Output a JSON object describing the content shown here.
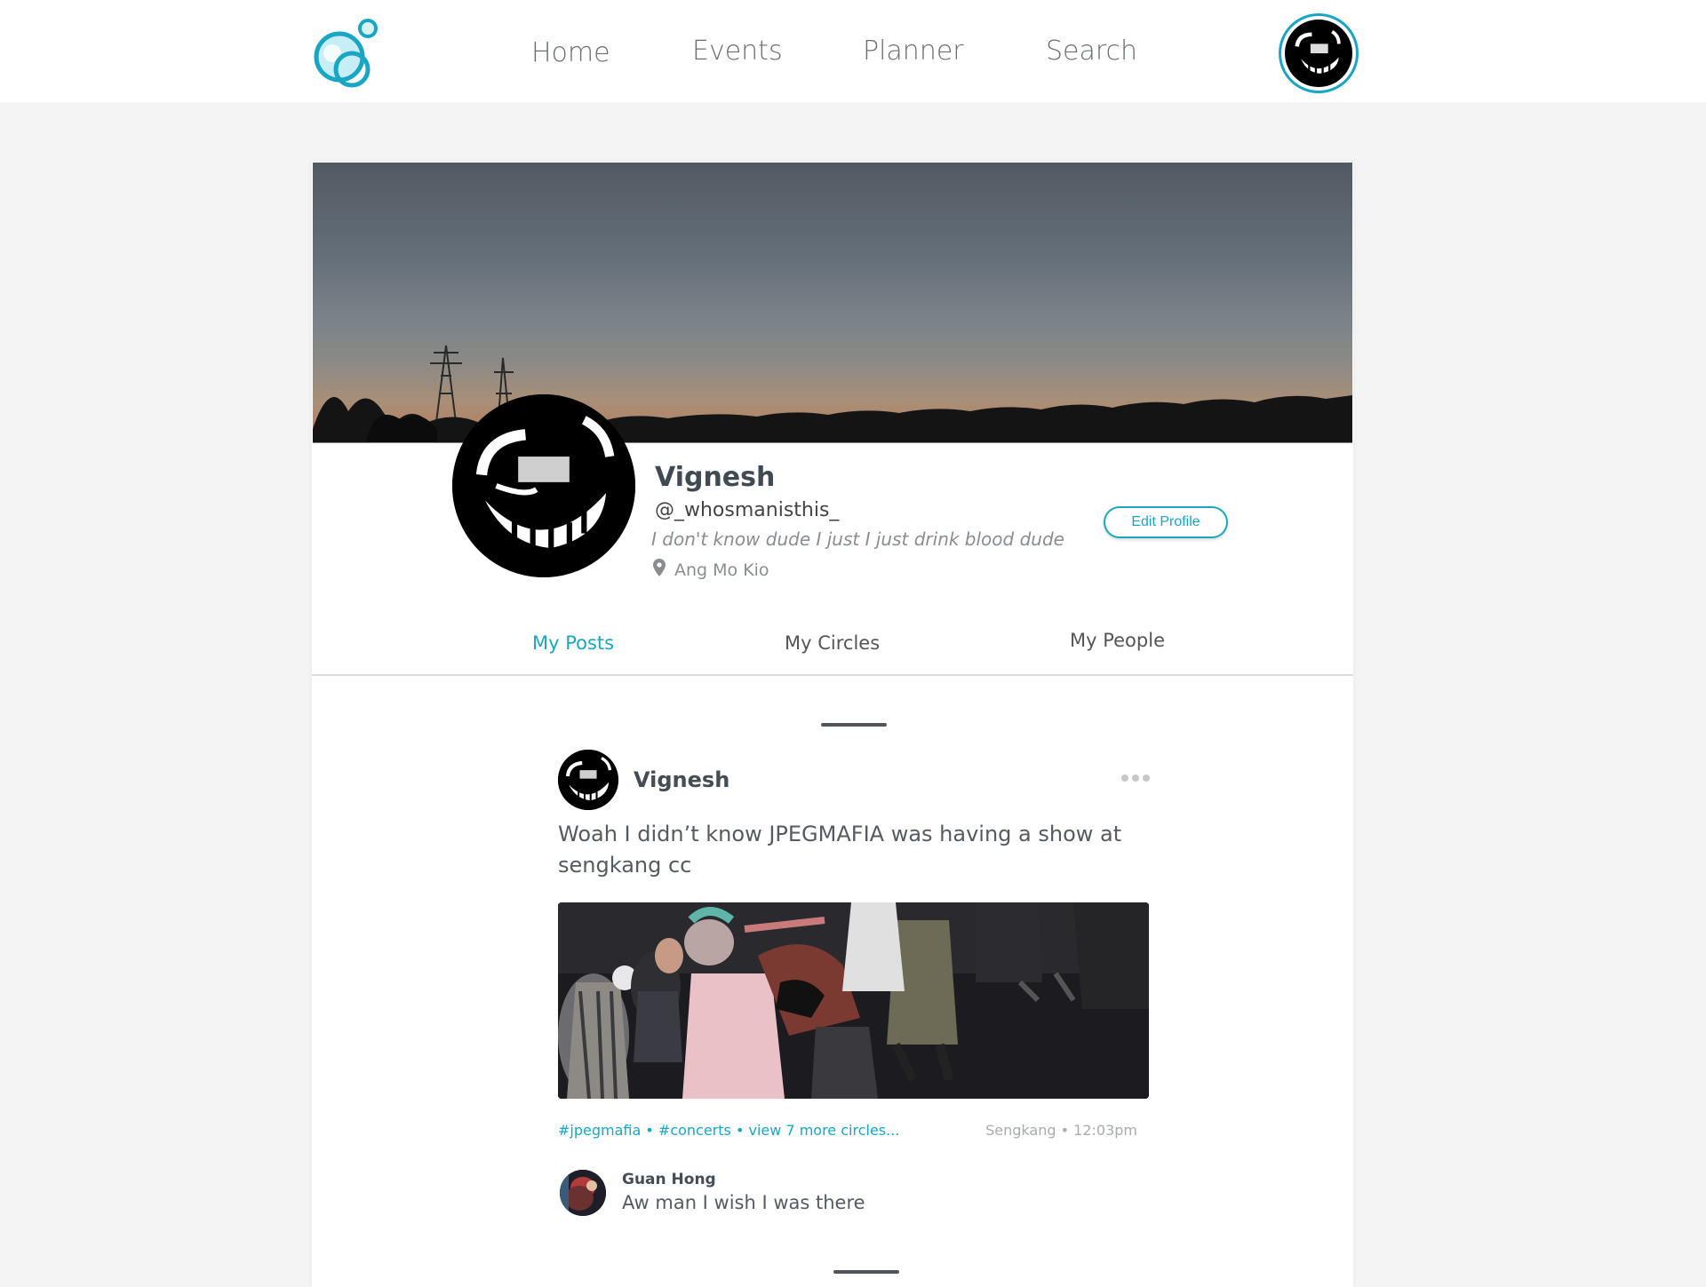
{
  "nav": {
    "items": [
      "Home",
      "Events",
      "Planner",
      "Search"
    ]
  },
  "profile": {
    "name": "Vignesh",
    "handle": "@_whosmanisthis_",
    "bio": "I don't know dude I just I just drink blood dude",
    "location": "Ang Mo Kio",
    "edit_label": "Edit Profile"
  },
  "tabs": [
    "My Posts",
    "My Circles",
    "My People"
  ],
  "post": {
    "author": "Vignesh",
    "text": "Woah I didn’t know JPEGMAFIA was having a show at sengkang cc",
    "tags": [
      "#jpegmafia",
      "#concerts"
    ],
    "more_circles": "view 7 more circles...",
    "location": "Sengkang",
    "time": "12:03pm",
    "comment": {
      "author": "Guan Hong",
      "text": "Aw man I wish I was there"
    }
  },
  "colors": {
    "accent": "#19a6c4",
    "page_bg": "#f4f4f4",
    "text": "#3e4448"
  },
  "icons": {
    "logo": "bubbles-logo-icon",
    "location": "map-pin-icon",
    "more": "more-dots-icon"
  }
}
